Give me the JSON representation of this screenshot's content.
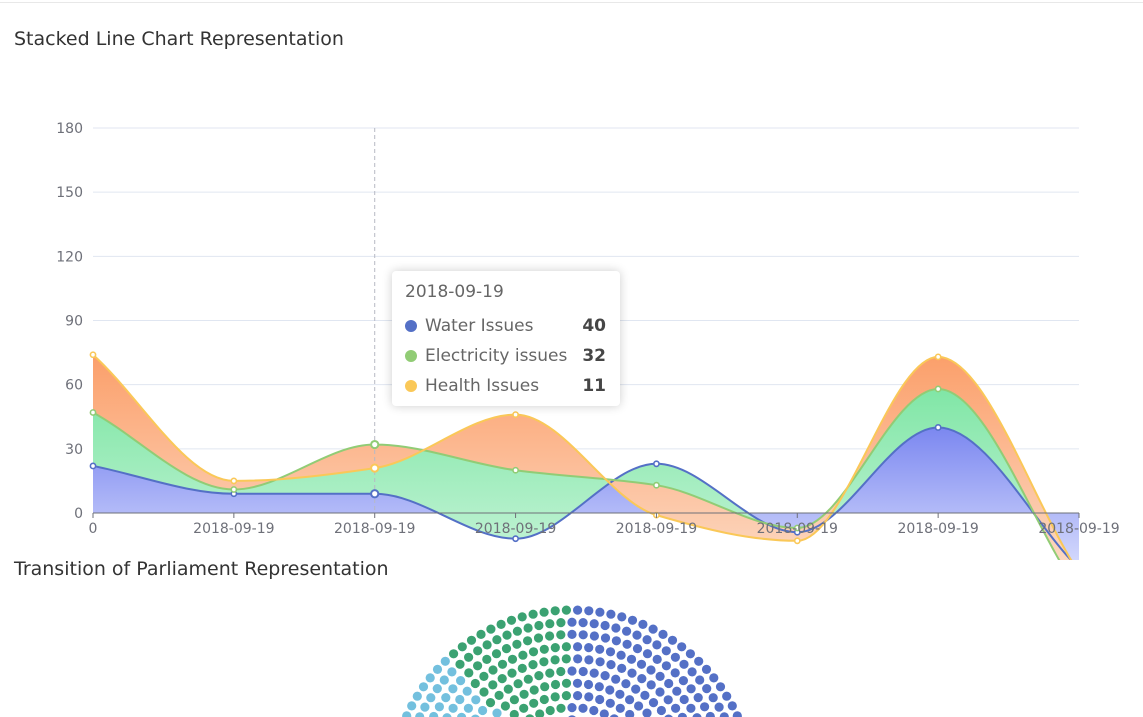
{
  "titles": {
    "stacked": "Stacked Line Chart Representation",
    "parliament": "Transition of Parliament Representation"
  },
  "colors": {
    "water": "#5470c6",
    "electricity": "#91cc75",
    "health": "#fac858",
    "parl_blue": "#5470c6",
    "parl_green": "#3ba272",
    "parl_cyan": "#73c0de"
  },
  "chart_data": {
    "type": "line",
    "stacked": true,
    "smooth": true,
    "area": true,
    "x": [
      "0",
      "2018-09-19",
      "2018-09-19",
      "2018-09-19",
      "2018-09-19",
      "2018-09-19",
      "2018-09-19",
      "2018-09-19"
    ],
    "series": [
      {
        "name": "Water Issues",
        "values": [
          22,
          9,
          9,
          -12,
          23,
          -9,
          40,
          -26
        ]
      },
      {
        "name": "Electricity issues",
        "values": [
          25,
          2,
          23,
          32,
          -10,
          2,
          18,
          -11
        ]
      },
      {
        "name": "Health Issues",
        "values": [
          27,
          4,
          -11,
          26,
          -14,
          -6,
          15,
          9
        ]
      }
    ],
    "ylim": [
      0,
      180
    ],
    "yticks": [
      0,
      30,
      60,
      90,
      120,
      150,
      180
    ],
    "grid": true,
    "highlight_index": 2
  },
  "tooltip": {
    "title": "2018-09-19",
    "rows": [
      {
        "name": "Water Issues",
        "value": "40",
        "color": "#5470c6"
      },
      {
        "name": "Electricity issues",
        "value": "32",
        "color": "#91cc75"
      },
      {
        "name": "Health Issues",
        "value": "11",
        "color": "#fac858"
      }
    ]
  }
}
